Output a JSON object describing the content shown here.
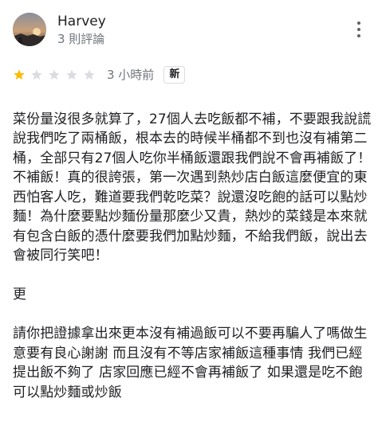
{
  "reviewer": {
    "name": "Harvey",
    "meta": "3 則評論"
  },
  "rating": {
    "value": 1,
    "max": 5,
    "filled_color": "#fbbc04",
    "empty_color": "#dadce0"
  },
  "review": {
    "time_ago": "3 小時前",
    "badge": "新",
    "paragraphs": [
      "菜份量沒很多就算了，27個人去吃飯都不補，不要跟我說謊說我們吃了兩桶飯，根本去的時候半桶都不到也沒有補第二桶，全部只有27個人吃你半桶飯還跟我們說不會再補飯了！不補飯！真的很誇張，第一次遇到熱炒店白飯這麼便宜的東西怕客人吃，難道要我們乾吃菜？說還沒吃飽的話可以點炒麵！為什麼要點炒麵份量那麼少又貴，熱炒的菜錢是本來就有包含白飯的憑什麼要我們加點炒麵，不給我們飯，說出去會被同行笑吧！",
      "更",
      "請你把證據拿出來更本沒有補過飯可以不要再騙人了嗎做生意要有良心謝謝 而且沒有不等店家補飯這種事情 我們已經提出飯不夠了 店家回應已經不會再補飯了 如果還是吃不飽可以點炒麵或炒飯"
    ]
  },
  "icons": {
    "more": "more-vert-icon",
    "star": "star-icon"
  }
}
